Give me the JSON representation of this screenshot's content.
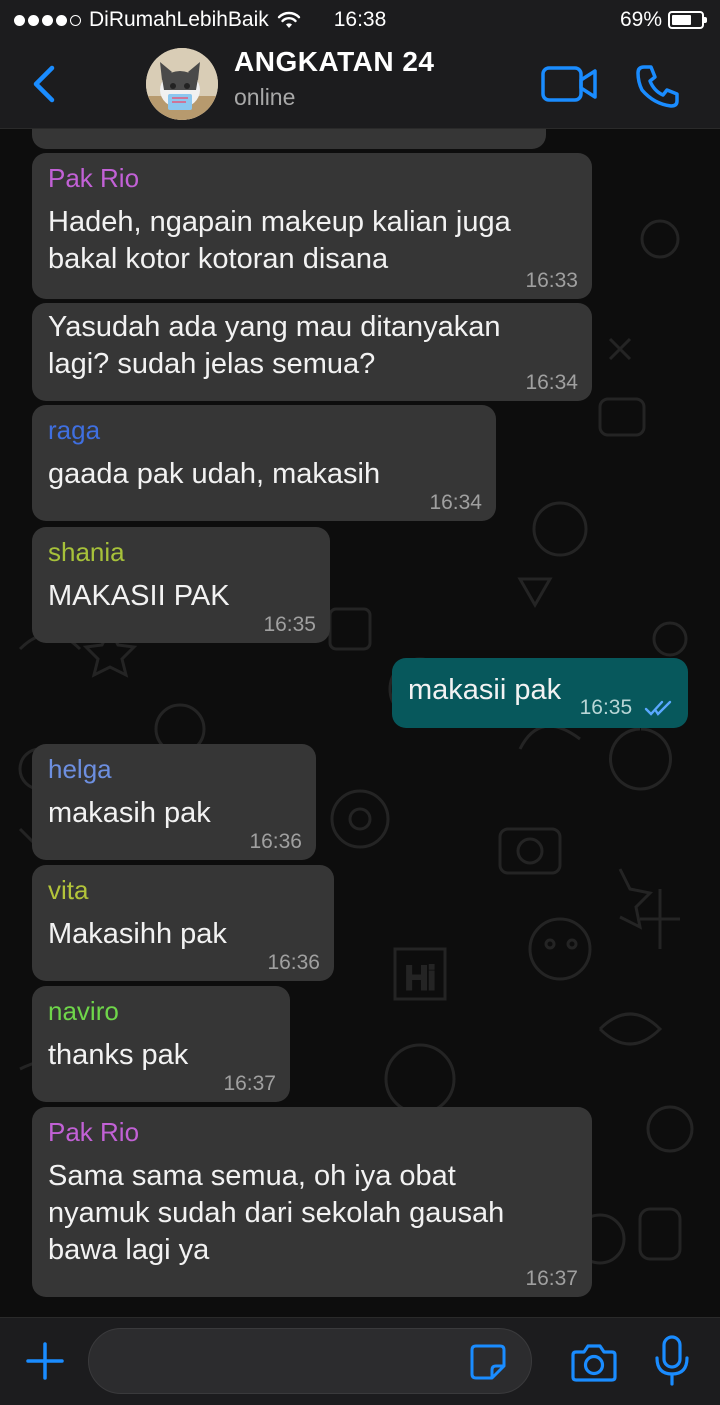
{
  "status_bar": {
    "carrier": "DiRumahLebihBaik",
    "time": "16:38",
    "battery": "69%",
    "battery_level": 0.69
  },
  "header": {
    "title": "ANGKATAN 24",
    "subtitle": "online"
  },
  "messages": [
    {
      "sender": "Pak Rio",
      "sender_color": "#c261d6",
      "text": "Hadeh, ngapain makeup kalian juga bakal kotor kotoran disana",
      "time": "16:33",
      "direction": "in"
    },
    {
      "sender": "",
      "text": "Yasudah ada yang mau ditanyakan lagi? sudah jelas semua?",
      "time": "16:34",
      "direction": "in"
    },
    {
      "sender": "raga",
      "sender_color": "#3f6fe0",
      "text": "gaada pak udah, makasih",
      "time": "16:34",
      "direction": "in"
    },
    {
      "sender": "shania",
      "sender_color": "#a7c23a",
      "text": "MAKASII PAK",
      "time": "16:35",
      "direction": "in"
    },
    {
      "sender": "",
      "text": "makasii pak",
      "time": "16:35",
      "direction": "out",
      "status": "read"
    },
    {
      "sender": "helga",
      "sender_color": "#6d8fe0",
      "text": "makasih pak",
      "time": "16:36",
      "direction": "in"
    },
    {
      "sender": "vita",
      "sender_color": "#b3c43a",
      "text": "Makasihh pak",
      "time": "16:36",
      "direction": "in"
    },
    {
      "sender": "naviro",
      "sender_color": "#6fd64a",
      "text": "thanks pak",
      "time": "16:37",
      "direction": "in"
    },
    {
      "sender": "Pak Rio",
      "sender_color": "#c261d6",
      "text": "Sama sama semua, oh iya obat nyamuk sudah dari sekolah gausah bawa lagi ya",
      "time": "16:37",
      "direction": "in"
    }
  ],
  "input": {
    "value": "",
    "placeholder": ""
  },
  "colors": {
    "accent": "#1a8cff",
    "incoming_bubble": "#363636",
    "outgoing_bubble": "#07585c"
  },
  "icons": [
    "back-chevron-icon",
    "video-camera-icon",
    "phone-icon",
    "plus-icon",
    "sticker-icon",
    "camera-icon",
    "microphone-icon",
    "double-check-icon",
    "wifi-icon",
    "battery-icon"
  ]
}
